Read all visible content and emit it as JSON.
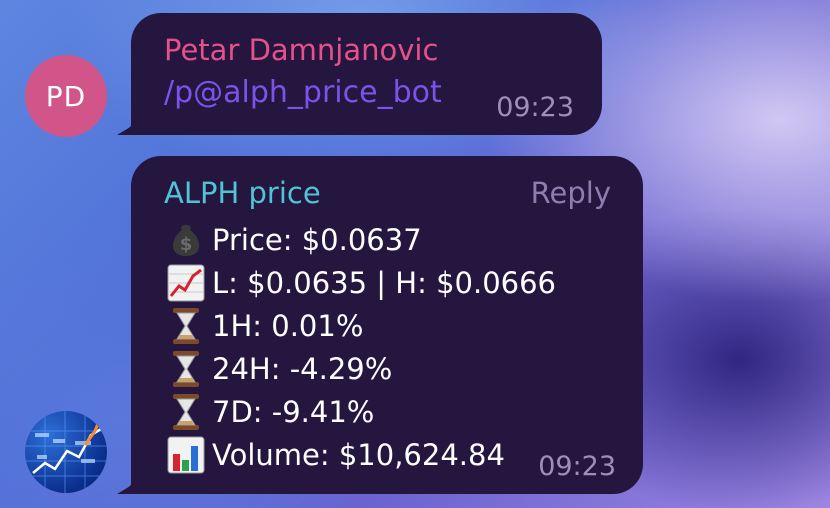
{
  "messages": [
    {
      "sender": "Petar Damnjanovic",
      "avatar_initials": "PD",
      "avatar_color": "#d2558a",
      "sender_color": "#e6508b",
      "text": "/p@alph_price_bot",
      "time": "09:23"
    },
    {
      "title": "ALPH price",
      "reply_label": "Reply",
      "time": "09:23",
      "lines": [
        {
          "icon": "money-bag-icon",
          "text": "Price: $0.0637"
        },
        {
          "icon": "chart-increasing-icon",
          "text": "L: $0.0635 | H: $0.0666"
        },
        {
          "icon": "hourglass-icon",
          "text": "1H: 0.01%"
        },
        {
          "icon": "hourglass-icon",
          "text": "24H: -4.29%"
        },
        {
          "icon": "hourglass-icon",
          "text": "7D: -9.41%"
        },
        {
          "icon": "bar-chart-icon",
          "text": "Volume: $10,624.84"
        }
      ]
    }
  ],
  "colors": {
    "bubble_bg": "#24163f",
    "title_color": "#52c3d4",
    "command_color": "#7b53e8",
    "time_color": "#9d8fbb"
  }
}
